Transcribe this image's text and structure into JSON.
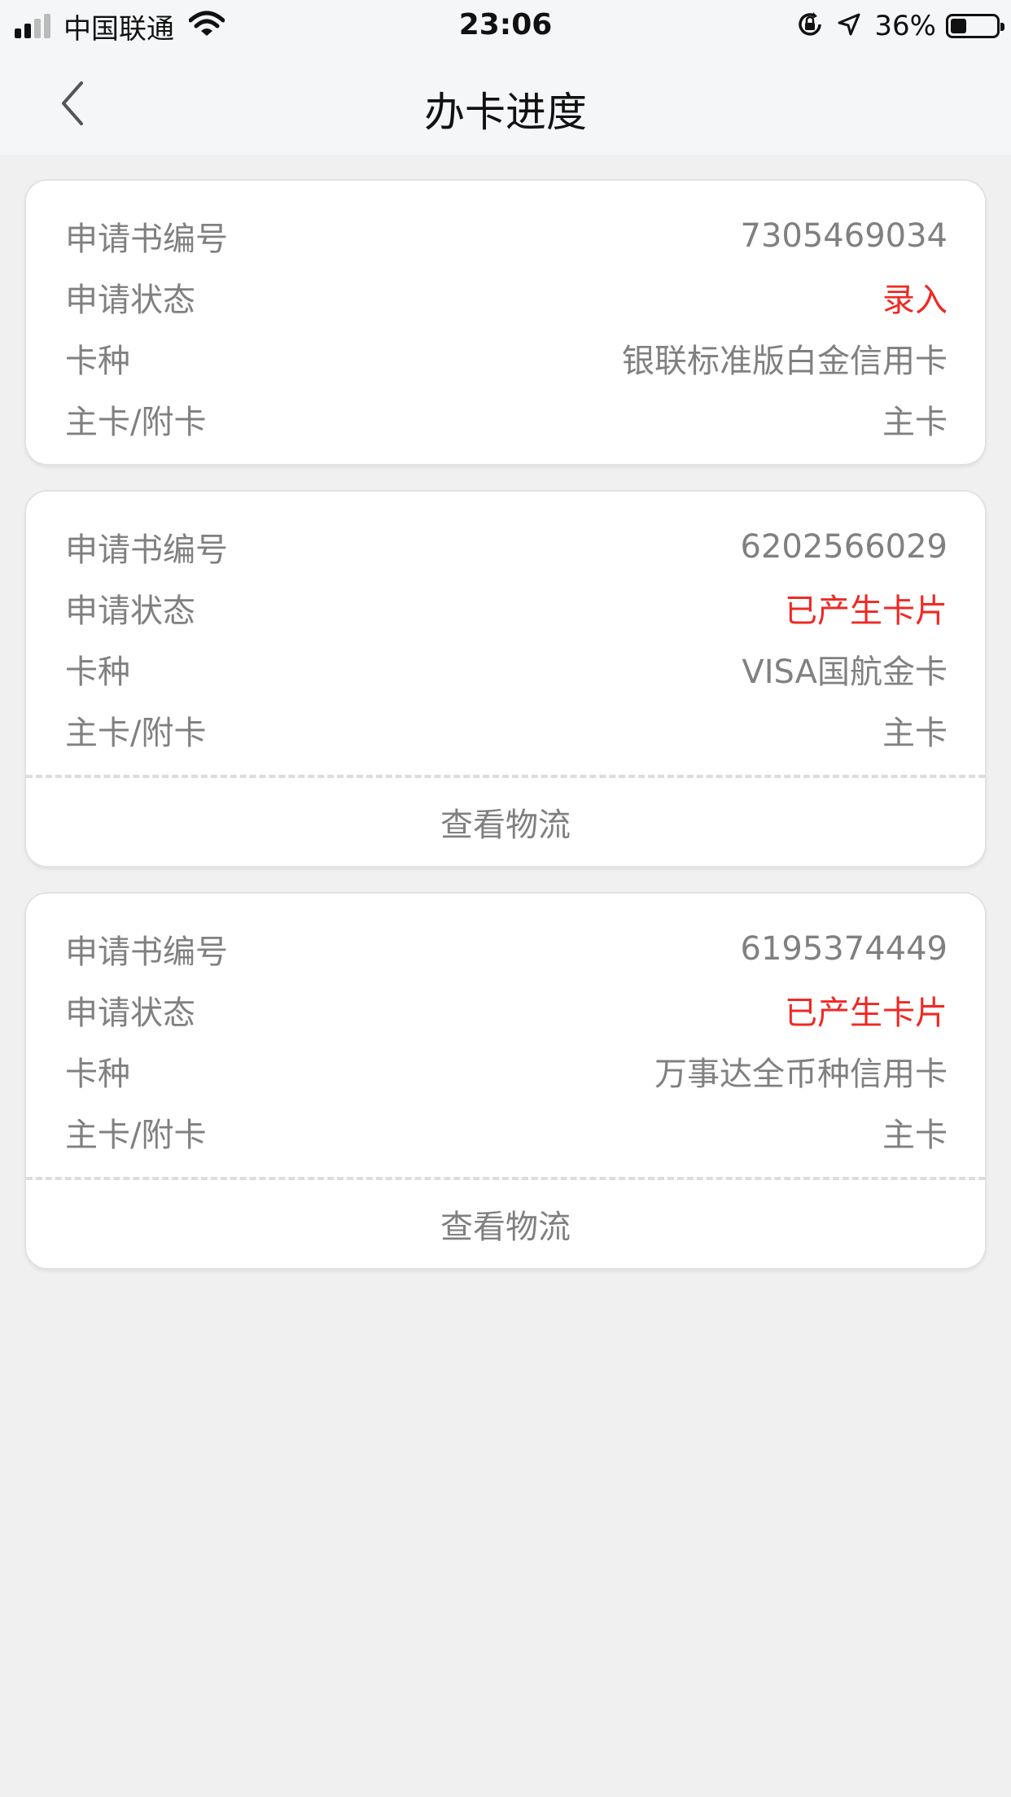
{
  "status_bar": {
    "carrier": "中国联通",
    "time": "23:06",
    "battery_percent": "36%",
    "battery_level": 0.36,
    "icons": [
      "signal-icon",
      "wifi-icon",
      "orientation-lock-icon",
      "location-arrow-icon",
      "battery-icon"
    ]
  },
  "nav": {
    "title": "办卡进度",
    "back_icon": "chevron-left-icon"
  },
  "colors": {
    "status_red": "#ee2a24",
    "text_gray": "#808080",
    "background": "#f0f0f0"
  },
  "labels": {
    "app_no": "申请书编号",
    "status": "申请状态",
    "card_type": "卡种",
    "main_sub": "主卡/附卡"
  },
  "cards": [
    {
      "app_no": "7305469034",
      "status": "录入",
      "card_type": "银联标准版白金信用卡",
      "main_sub": "主卡"
    },
    {
      "app_no": "6202566029",
      "status": "已产生卡片",
      "card_type": "VISA国航金卡",
      "main_sub": "主卡",
      "action": "查看物流"
    },
    {
      "app_no": "6195374449",
      "status": "已产生卡片",
      "card_type": "万事达全币种信用卡",
      "main_sub": "主卡",
      "action": "查看物流"
    }
  ]
}
